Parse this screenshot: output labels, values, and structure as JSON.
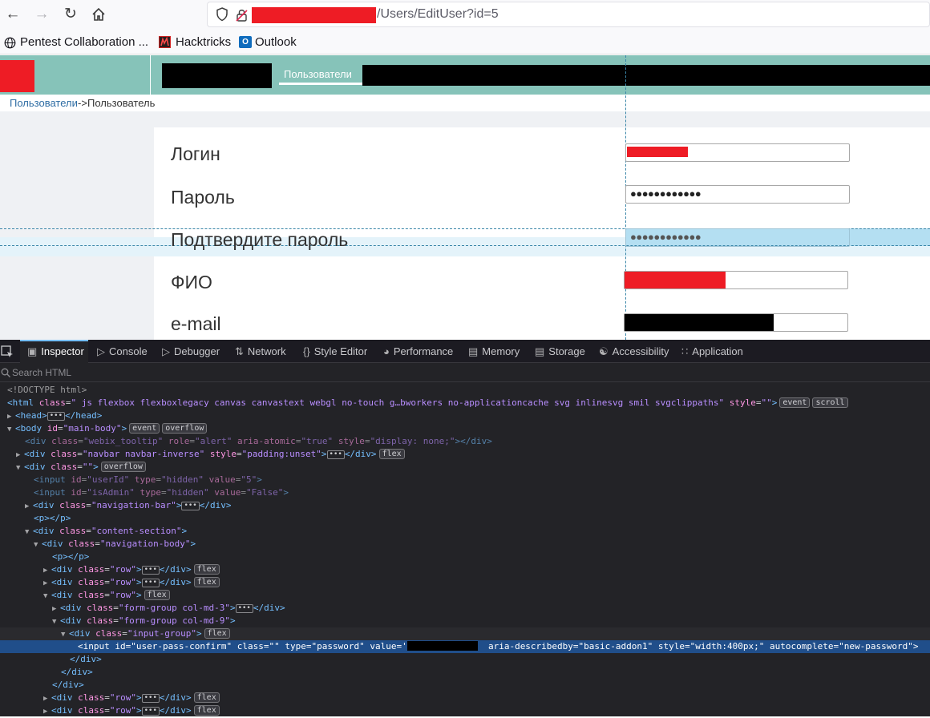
{
  "browser": {
    "url_suffix": "/Users/EditUser?id=5",
    "bookmarks": [
      {
        "label": "Pentest Collaboration ..."
      },
      {
        "label": "Hacktricks"
      },
      {
        "label": "Outlook"
      }
    ]
  },
  "app": {
    "nav_tab": "Пользователи",
    "breadcrumb_link": "Пользователи",
    "breadcrumb_sep": "->",
    "breadcrumb_current": "Пользователь",
    "fields": {
      "login": "Логин",
      "password": "Пароль",
      "password_value": "●●●●●●●●●●●●",
      "confirm": "Подтвердите пароль",
      "confirm_value": "●●●●●●●●●●●●",
      "fio": "ФИО",
      "email": "e-mail"
    }
  },
  "devtools": {
    "tabs": [
      "Inspector",
      "Console",
      "Debugger",
      "Network",
      "Style Editor",
      "Performance",
      "Memory",
      "Storage",
      "Accessibility",
      "Application"
    ],
    "search_placeholder": "Search HTML",
    "badges": {
      "event": "event",
      "scroll": "scroll",
      "overflow": "overflow",
      "flex": "flex"
    },
    "tree": {
      "doctype": "<!DOCTYPE html>",
      "html_class": "\" js flexbox flexboxlegacy canvas canvastext webgl no-touch g…bworkers no-applicationcache svg inlinesvg smil svgclippaths\"",
      "html_style": "\"\"",
      "body_id": "\"main-body\"",
      "tooltip_class": "\"webix_tooltip\"",
      "tooltip_role": "\"alert\"",
      "tooltip_aria": "\"true\"",
      "tooltip_style": "\"display: none;\"",
      "navbar_class": "\"navbar navbar-inverse\"",
      "navbar_style": "\"padding:unset\"",
      "empty_class": "\"\"",
      "input1_id": "\"userId\"",
      "input1_type": "\"hidden\"",
      "input1_value": "\"5\"",
      "input2_id": "\"isAdmin\"",
      "input2_type": "\"hidden\"",
      "input2_value": "\"False\"",
      "navigation_bar": "\"navigation-bar\"",
      "content_section": "\"content-section\"",
      "navigation_body": "\"navigation-body\"",
      "row_class": "\"row\"",
      "form_group3": "\"form-group col-md-3\"",
      "form_group9": "\"form-group col-md-9\"",
      "input_group": "\"input-group\"",
      "sel_id": "\"user-pass-confirm\"",
      "sel_class": "\"\"",
      "sel_type": "\"password\"",
      "sel_value_open": "'",
      "sel_aria": "\"basic-addon1\"",
      "sel_style": "\"width:400px;\"",
      "sel_autocomplete": "\"new-password\""
    }
  },
  "colors": {
    "header_teal": "#86c3b9",
    "redaction_red": "#ee1c25",
    "highlight_blue": "#b4dff2",
    "selected_row": "#204e8a"
  }
}
